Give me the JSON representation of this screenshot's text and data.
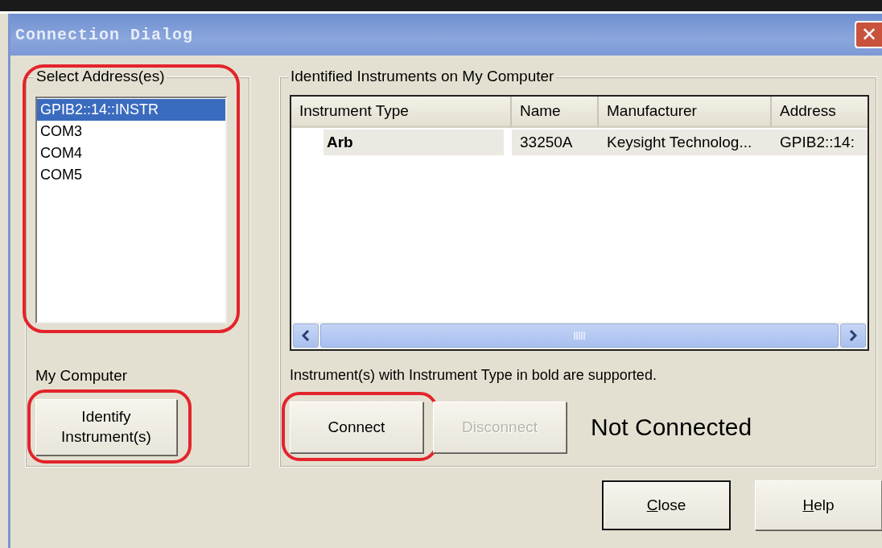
{
  "window": {
    "title": "Connection Dialog",
    "close_glyph": "✕"
  },
  "address_group": {
    "title": "Select Address(es)",
    "highlighted": true,
    "addresses": [
      {
        "label": "GPIB2::14::INSTR",
        "selected": true
      },
      {
        "label": "COM3",
        "selected": false
      },
      {
        "label": "COM4",
        "selected": false
      },
      {
        "label": "COM5",
        "selected": false
      }
    ]
  },
  "my_computer": {
    "label": "My Computer",
    "button": {
      "label": "Identify Instrument(s)",
      "highlighted": true
    }
  },
  "instruments_group": {
    "title": "Identified Instruments on My Computer",
    "table": {
      "columns": [
        "Instrument Type",
        "Name",
        "Manufacturer",
        "Address"
      ],
      "rows": [
        {
          "cells": [
            "Arb",
            "33250A",
            "Keysight Technolog...",
            "GPIB2::14:"
          ],
          "supported": true,
          "selected": true
        }
      ]
    },
    "note": "Instrument(s) with Instrument Type in bold are supported.",
    "buttons": [
      {
        "label": "Connect",
        "disabled": false,
        "highlighted": true
      },
      {
        "label": "Disconnect",
        "disabled": true,
        "highlighted": false
      }
    ],
    "status": "Not Connected"
  },
  "footer_buttons": [
    {
      "label": "Close",
      "default": true
    },
    {
      "label": "Help",
      "default": false
    }
  ]
}
